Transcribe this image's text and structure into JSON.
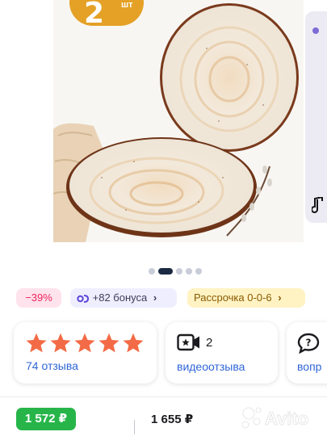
{
  "gallery": {
    "count_number": "2",
    "count_unit": "шт"
  },
  "badges": {
    "discount": "−39%",
    "bonus": "+82 бонуса",
    "installment": "Рассрочка 0-0-6"
  },
  "reviews": {
    "rating_stars": 5,
    "reviews_label": "74 отзыва",
    "video_count": "2",
    "video_label": "видеоотзыва",
    "questions_label": "вопр"
  },
  "price": {
    "current": "1 572 ₽",
    "old": "1 655 ₽"
  },
  "colors": {
    "accent_green": "#27b54a",
    "discount_red": "#f0245f",
    "link_blue": "#2f66d6",
    "star_orange": "#f36b46",
    "badge_orange": "#e4a126"
  },
  "watermark_text": "Avito"
}
